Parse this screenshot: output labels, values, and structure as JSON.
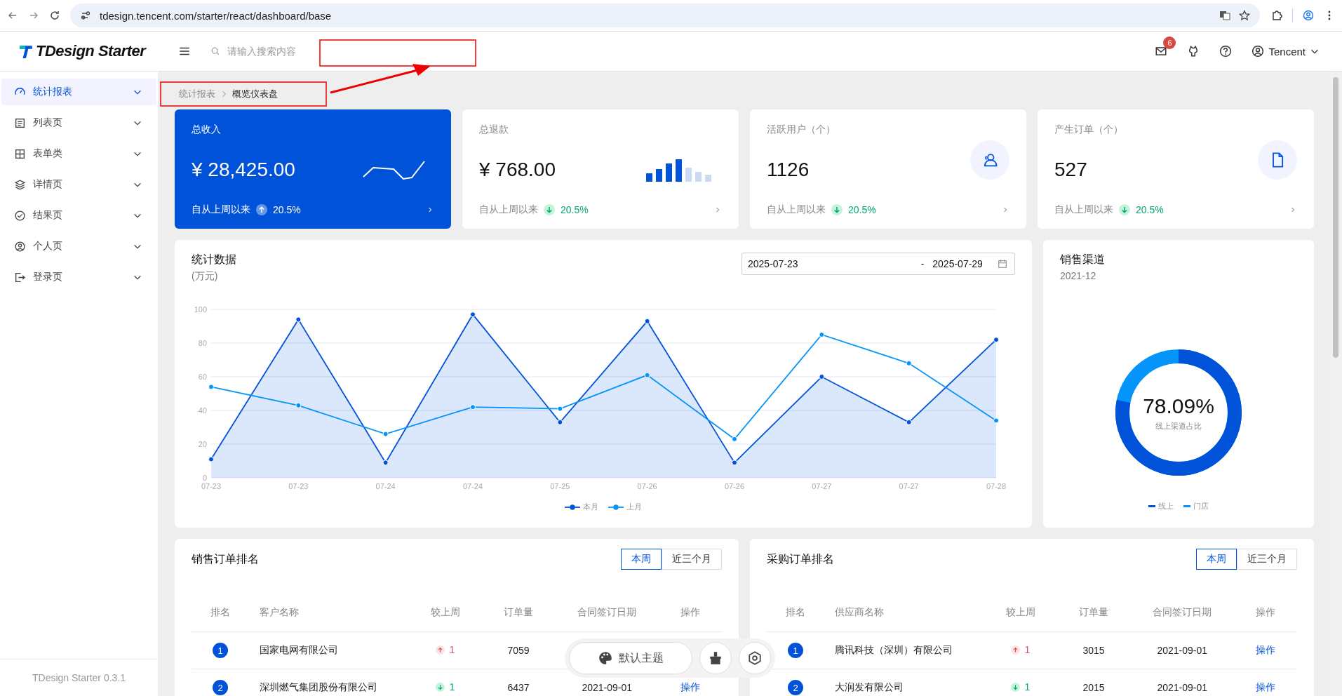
{
  "browser": {
    "url": "tdesign.tencent.com/starter/react/dashboard/base"
  },
  "header": {
    "logo": "TDesign Starter",
    "search_placeholder": "请输入搜索内容",
    "notification_count": "6",
    "user": "Tencent"
  },
  "sidebar": {
    "items": [
      {
        "label": "统计报表",
        "selected": true
      },
      {
        "label": "列表页",
        "selected": false
      },
      {
        "label": "表单类",
        "selected": false
      },
      {
        "label": "详情页",
        "selected": false
      },
      {
        "label": "结果页",
        "selected": false
      },
      {
        "label": "个人页",
        "selected": false
      },
      {
        "label": "登录页",
        "selected": false
      }
    ],
    "footer": "TDesign Starter 0.3.1"
  },
  "breadcrumb": [
    "统计报表",
    "概览仪表盘"
  ],
  "stat_cards": [
    {
      "kind": "revenue",
      "title": "总收入",
      "value": "¥ 28,425.00",
      "highlighted": true,
      "footer": "自从上周以来",
      "rising": true,
      "change": "20.5%"
    },
    {
      "kind": "refund",
      "title": "总退款",
      "value": "¥ 768.00",
      "highlighted": false,
      "footer": "自从上周以来",
      "rising": false,
      "change": "20.5%"
    },
    {
      "kind": "users",
      "title": "活跃用户（个）",
      "value": "1126",
      "highlighted": false,
      "footer": "自从上周以来",
      "rising": false,
      "change": "20.5%"
    },
    {
      "kind": "orders",
      "title": "产生订单（个）",
      "value": "527",
      "highlighted": false,
      "footer": "自从上周以来",
      "rising": false,
      "change": "20.5%"
    }
  ],
  "stats_chart": {
    "title": "统计数据",
    "unit": "(万元)",
    "date_start": "2025-07-23",
    "date_separator": "-",
    "date_end": "2025-07-29",
    "chart_data": {
      "type": "line",
      "grid": true,
      "categories": [
        "07-23",
        "07-23",
        "07-24",
        "07-24",
        "07-25",
        "07-26",
        "07-26",
        "07-27",
        "07-27",
        "07-28"
      ],
      "series": [
        {
          "name": "本月",
          "color": "#0052d9",
          "marker": "o",
          "type": "area",
          "values": [
            11,
            94,
            9,
            97,
            33,
            93,
            9,
            60,
            33,
            82
          ]
        },
        {
          "name": "上月",
          "color": "#0594fa",
          "marker": "o",
          "type": "line",
          "values": [
            54,
            43,
            26,
            42,
            41,
            61,
            23,
            85,
            68,
            34
          ]
        }
      ],
      "ylim": [
        0,
        100
      ],
      "yticks": [
        0,
        20,
        40,
        60,
        80,
        100
      ]
    }
  },
  "sales_channel": {
    "title": "销售渠道",
    "date": "2021-12",
    "value": "78.09%",
    "caption": "线上渠道占比",
    "level": 0.7809,
    "legend": [
      {
        "name": "线上",
        "color": "#0052d9"
      },
      {
        "name": "门店",
        "color": "#0594fa"
      }
    ]
  },
  "rankings": [
    {
      "title": "销售订单排名",
      "tabs": [
        {
          "label": "本周",
          "selected": true
        },
        {
          "label": "近三个月",
          "selected": false
        }
      ],
      "columns": [
        "排名",
        "客户名称",
        "较上周",
        "订单量",
        "合同签订日期",
        "操作"
      ],
      "rows": [
        {
          "rank": "1",
          "name": "国家电网有限公司",
          "rising": true,
          "change": "1",
          "orders": "7059"
        },
        {
          "rank": "2",
          "name": "深圳燃气集团股份有限公司",
          "rising": false,
          "change": "1",
          "orders": "6437",
          "date": "2021-09-01",
          "action": "操作"
        }
      ]
    },
    {
      "title": "采购订单排名",
      "tabs": [
        {
          "label": "本周",
          "selected": true
        },
        {
          "label": "近三个月",
          "selected": false
        }
      ],
      "columns": [
        "排名",
        "供应商名称",
        "较上周",
        "订单量",
        "合同签订日期",
        "操作"
      ],
      "rows": [
        {
          "rank": "1",
          "name": "腾讯科技（深圳）有限公司",
          "rising": true,
          "change": "1",
          "orders": "3015",
          "date": "2021-09-01",
          "action": "操作"
        },
        {
          "rank": "2",
          "name": "大润发有限公司",
          "rising": false,
          "change": "1",
          "orders": "2015",
          "date": "2021-09-01",
          "action": "操作"
        }
      ]
    }
  ],
  "theme_bar": {
    "label": "默认主题"
  }
}
